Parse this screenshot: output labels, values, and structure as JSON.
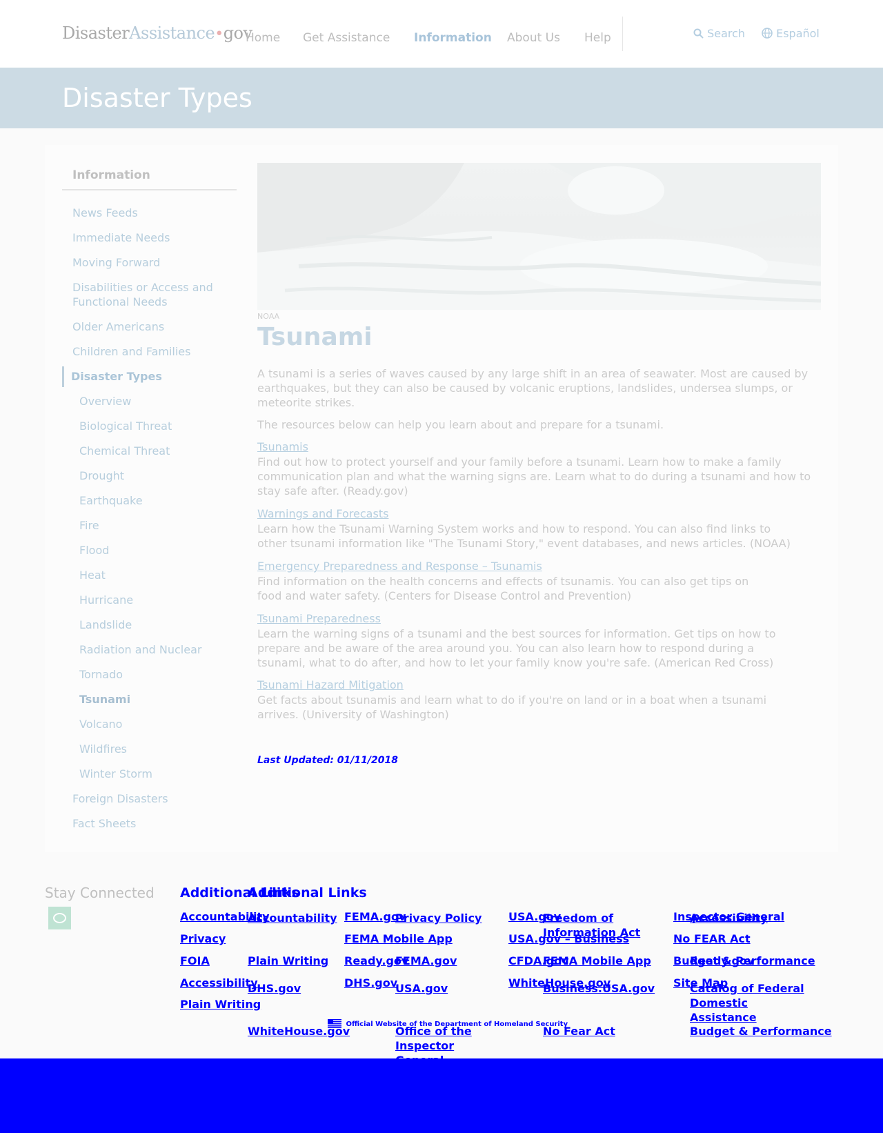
{
  "header": {
    "logo": {
      "part1": "Disaster",
      "part2": "Assistance",
      "dot": "•",
      "part3": "gov"
    },
    "nav": [
      "Home",
      "Get Assistance",
      "Information",
      "About Us",
      "Help"
    ],
    "search_label": "Search",
    "language_label": "Español",
    "icons": {
      "search": "search-icon",
      "language": "globe-icon"
    }
  },
  "banner": {
    "title": "Disaster Types"
  },
  "sidebar": {
    "heading": "Information",
    "items_before": [
      "News Feeds",
      "Immediate Needs",
      "Moving Forward",
      "Disabilities or Access and Functional Needs",
      "Older Americans",
      "Children and Families"
    ],
    "current": "Disaster Types",
    "subitems": [
      "Overview",
      "Biological Threat",
      "Chemical Threat",
      "Drought",
      "Earthquake",
      "Fire",
      "Flood",
      "Heat",
      "Hurricane",
      "Landslide",
      "Radiation and Nuclear",
      "Tornado",
      "Tsunami",
      "Volcano",
      "Wildfires",
      "Winter Storm"
    ],
    "selected_subitem": "Tsunami",
    "items_after": [
      "Foreign Disasters",
      "Fact Sheets"
    ]
  },
  "main": {
    "image_credit": "NOAA",
    "title": "Tsunami",
    "intro": "A tsunami is a series of waves caused by any large shift in an area of seawater. Most are caused by earthquakes, but they can also be caused by volcanic eruptions, landslides, undersea slumps, or meteorite strikes.",
    "lead": "The resources below can help you learn about and prepare for a tsunami.",
    "resources": [
      {
        "link": "Tsunamis",
        "desc": "Find out how to protect yourself and your family before a tsunami. Learn how to make a family communication plan and what the warning signs are. Learn what to do during a tsunami and how to stay safe after. (Ready.gov)"
      },
      {
        "link": "Warnings and Forecasts",
        "desc": "Learn how the Tsunami Warning System works and how to respond. You can also find links to other tsunami information like \"The Tsunami Story,\" event databases, and news articles. (NOAA)"
      },
      {
        "link": "Emergency Preparedness and Response – Tsunamis",
        "desc": "Find information on the health concerns and effects of tsunamis. You can also get tips on food and water safety. (Centers for Disease Control and Prevention)"
      },
      {
        "link": "Tsunami Preparedness",
        "desc": "Learn the warning signs of a tsunami and the best sources for information. Get tips on how to prepare and be aware of the area around you. You can also learn how to respond during a tsunami, what to do after, and how to let your family know you're safe. (American Red Cross)"
      },
      {
        "link": "Tsunami Hazard Mitigation",
        "desc": "Get facts about tsunamis and learn what to do if you're on land or in a boat when a tsunami arrives. (University of Washington)"
      }
    ],
    "last_updated": "Last Updated: 01/11/2018"
  },
  "footer": {
    "stay_connected": "Stay Connected",
    "heading_a": "Additional Links",
    "heading_b": "Additional Links",
    "layer_a": [
      "Accountability",
      "Privacy",
      "FOIA",
      "Accessibility",
      "Plain Writing",
      "FEMA.gov",
      "FEMA Mobile App",
      "Ready.gov",
      "DHS.gov",
      "USA.gov",
      "USA.gov – Business",
      "CFDA.gov",
      "WhiteHouse.gov",
      "Inspector General",
      "No FEAR Act",
      "Budget & Performance",
      "Site Map"
    ],
    "layer_b": [
      "Accountability",
      "Plain Writing",
      "DHS.gov",
      "WhiteHouse.gov",
      "Privacy Policy",
      "FEMA.gov",
      "USA.gov",
      "Office of the Inspector General",
      "Freedom of Information Act",
      "FEMA Mobile App",
      "Business.USA.gov",
      "No Fear Act",
      "Accessibility",
      "Ready.gov",
      "Catalog of Federal Domestic Assistance",
      "Budget & Performance"
    ],
    "official": "Official Website of the Department of Homeland Security",
    "colors": {
      "link": "#0000ff",
      "band": "#0000ff"
    }
  }
}
